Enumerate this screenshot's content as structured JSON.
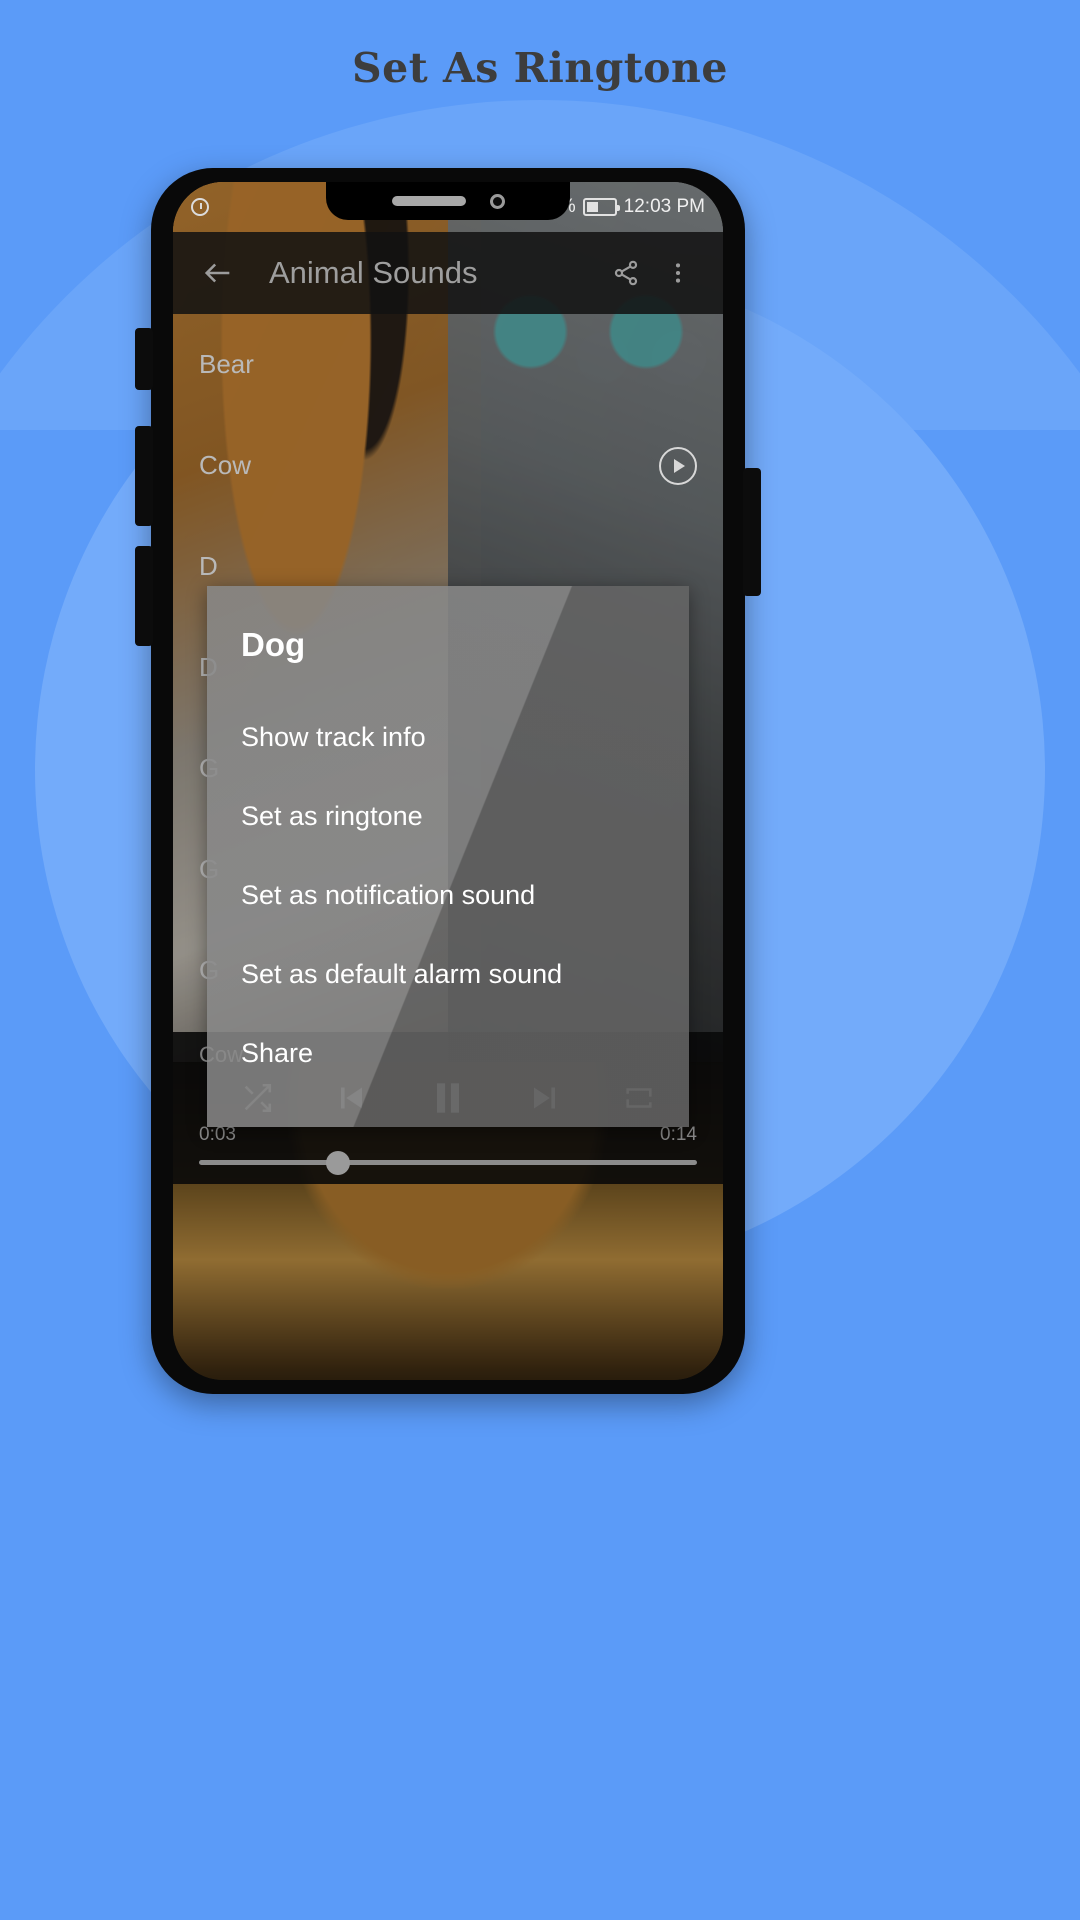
{
  "page": {
    "title": "Set As Ringtone",
    "background_color": "#5b9bf8",
    "title_color": "#3d3d3d"
  },
  "status_bar": {
    "left_icon": "alarm-clock-icon",
    "signal_label": "%",
    "battery_icon": "battery-icon",
    "time": "12:03 PM"
  },
  "toolbar": {
    "back_icon": "arrow-left-icon",
    "title": "Animal Sounds",
    "share_icon": "share-icon",
    "overflow_icon": "more-vertical-icon"
  },
  "tracklist": {
    "items": [
      {
        "label": "Bear",
        "playing": false
      },
      {
        "label": "Cow",
        "playing": true
      },
      {
        "label": "D",
        "playing": false
      },
      {
        "label": "D",
        "playing": false
      },
      {
        "label": "G",
        "playing": false
      },
      {
        "label": "G",
        "playing": false
      },
      {
        "label": "G",
        "playing": false
      }
    ]
  },
  "dialog": {
    "title": "Dog",
    "items": [
      {
        "label": "Show track info"
      },
      {
        "label": "Set as ringtone"
      },
      {
        "label": "Set as notification sound"
      },
      {
        "label": "Set as default alarm sound"
      },
      {
        "label": "Share"
      }
    ]
  },
  "player": {
    "now_playing": "Cow",
    "shuffle_icon": "shuffle-icon",
    "previous_icon": "skip-previous-icon",
    "play_pause_icon": "pause-icon",
    "next_icon": "skip-next-icon",
    "repeat_icon": "repeat-icon",
    "elapsed": "0:03",
    "duration": "0:14",
    "progress_percent": 28
  }
}
